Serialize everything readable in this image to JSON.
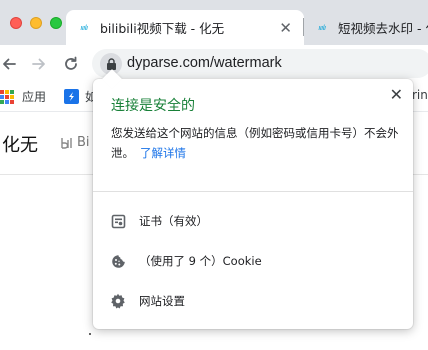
{
  "tabs": [
    {
      "title": "bilibili视频下载 - 化无",
      "close": "✕",
      "active": true
    },
    {
      "title": "短视频去水印 - 化无",
      "close": "",
      "active": false
    }
  ],
  "toolbar": {
    "back": "←",
    "forward": "→",
    "reload": "↻",
    "url": "dyparse.com/watermark"
  },
  "bookmarks": [
    {
      "label": "应用",
      "icon": "apps-grid-icon"
    },
    {
      "label": "如",
      "icon": "blue-bookmark-icon"
    },
    {
      "label": "ring",
      "icon": ""
    }
  ],
  "page": {
    "site_name": "化无",
    "logo_text": "Bi"
  },
  "popup": {
    "close": "✕",
    "title": "连接是安全的",
    "description": "您发送给这个网站的信息（例如密码或信用卡号）不会外泄。",
    "learn_more": "了解详情",
    "rows": [
      {
        "label": "证书（有效）",
        "icon": "certificate-icon"
      },
      {
        "label": "（使用了 9 个）Cookie",
        "icon": "cookie-icon"
      },
      {
        "label": "网站设置",
        "icon": "gear-icon"
      }
    ]
  },
  "colors": {
    "secure_green": "#188038",
    "link_blue": "#1a73e8",
    "tabstrip": "#dee1e6",
    "omnibox": "#f1f3f4"
  }
}
